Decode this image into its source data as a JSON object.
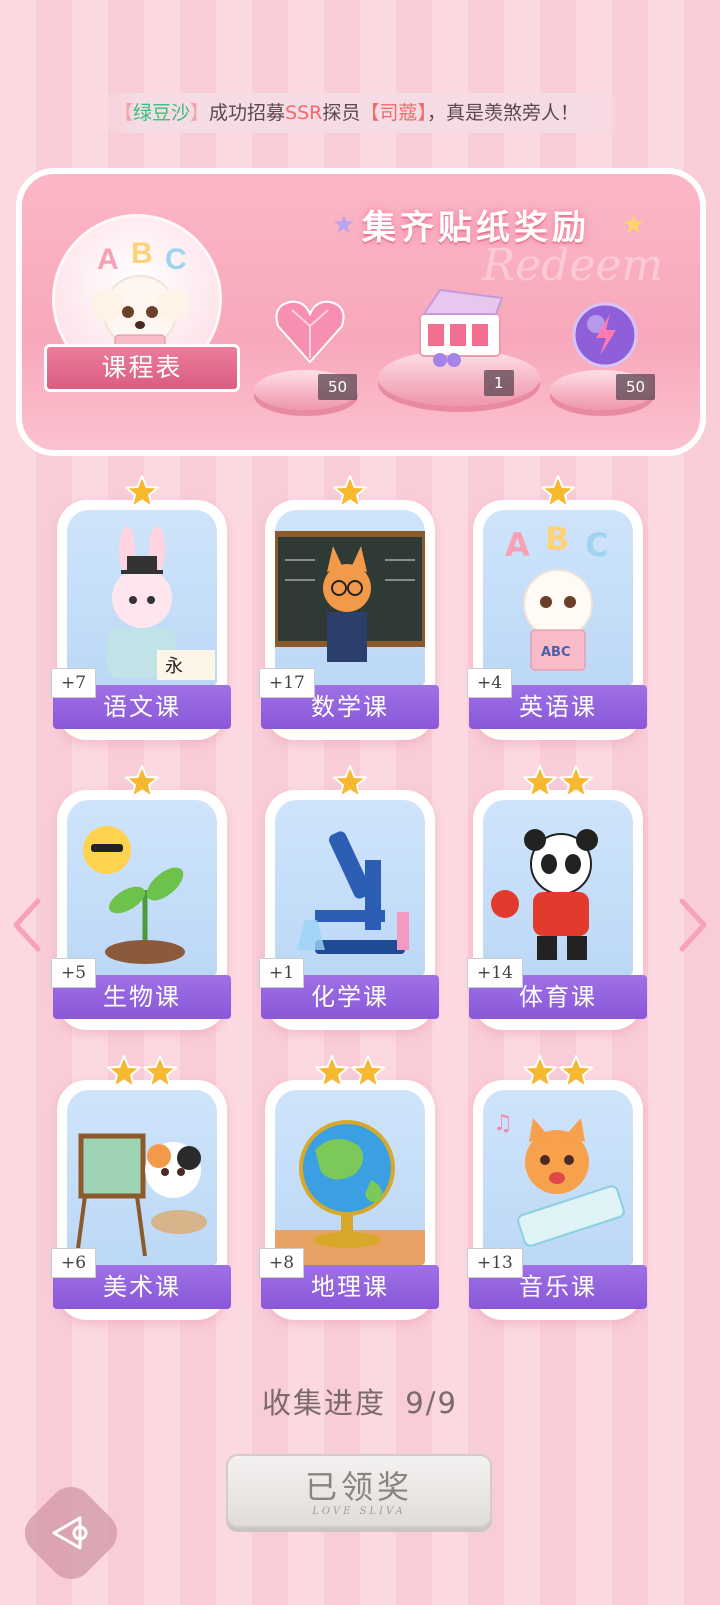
{
  "ticker": {
    "open1": "【",
    "name": "绿豆沙",
    "close1": "】",
    "mid": "成功招募",
    "rank": "SSR",
    "role": "探员",
    "open2": "【",
    "target": "司蔻",
    "close2": "】",
    "tail": "，真是羡煞旁人！"
  },
  "banner": {
    "title": "集齐贴纸奖励",
    "watermark": "Redeem",
    "schedule_label": "课程表",
    "rewards": [
      {
        "icon": "pink-heart-gem-icon",
        "count": "50"
      },
      {
        "icon": "gift-box-icon",
        "count": "1"
      },
      {
        "icon": "purple-orb-icon",
        "count": "50"
      }
    ]
  },
  "cards": [
    {
      "label": "语文课",
      "count": "+7",
      "stars": 1
    },
    {
      "label": "数学课",
      "count": "+17",
      "stars": 1
    },
    {
      "label": "英语课",
      "count": "+4",
      "stars": 1
    },
    {
      "label": "生物课",
      "count": "+5",
      "stars": 1
    },
    {
      "label": "化学课",
      "count": "+1",
      "stars": 1
    },
    {
      "label": "体育课",
      "count": "+14",
      "stars": 2
    },
    {
      "label": "美术课",
      "count": "+6",
      "stars": 2
    },
    {
      "label": "地理课",
      "count": "+8",
      "stars": 2
    },
    {
      "label": "音乐课",
      "count": "+13",
      "stars": 2
    }
  ],
  "progress": {
    "label": "收集进度",
    "value": "9/9"
  },
  "claimed_button": {
    "label": "已领奖",
    "sub": "LOVE SLIVA"
  },
  "colors": {
    "accent_purple": "#8a58d8",
    "pink": "#f8a8bb",
    "star_gold": "#f5b82e"
  }
}
